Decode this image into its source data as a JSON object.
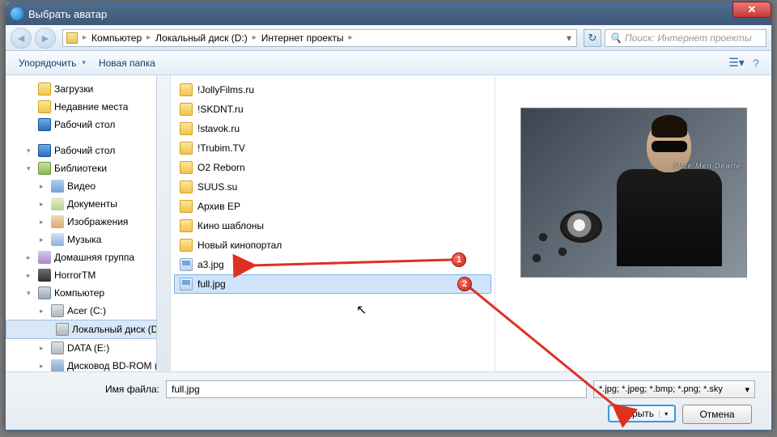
{
  "title": "Выбрать аватар",
  "breadcrumb": [
    "Компьютер",
    "Локальный диск (D:)",
    "Интернет проекты"
  ],
  "search_placeholder": "Поиск: Интернет проекты",
  "toolbar": {
    "organize": "Упорядочить",
    "newfolder": "Новая папка"
  },
  "tree": [
    {
      "t": "Загрузки",
      "c": "folder",
      "l": 1
    },
    {
      "t": "Недавние места",
      "c": "folder",
      "l": 1
    },
    {
      "t": "Рабочий стол",
      "c": "desktop",
      "l": 1
    },
    {
      "t": "",
      "spacer": true
    },
    {
      "t": "Рабочий стол",
      "c": "desktop",
      "l": 0,
      "exp": "▾"
    },
    {
      "t": "Библиотеки",
      "c": "lib",
      "l": 1,
      "exp": "▾"
    },
    {
      "t": "Видео",
      "c": "vid",
      "l": 2,
      "exp": "▸"
    },
    {
      "t": "Документы",
      "c": "doc",
      "l": 2,
      "exp": "▸"
    },
    {
      "t": "Изображения",
      "c": "img",
      "l": 2,
      "exp": "▸"
    },
    {
      "t": "Музыка",
      "c": "mus",
      "l": 2,
      "exp": "▸"
    },
    {
      "t": "Домашняя группа",
      "c": "grp",
      "l": 1,
      "exp": "▸"
    },
    {
      "t": "HorrorTM",
      "c": "tm",
      "l": 1,
      "exp": "▸"
    },
    {
      "t": "Компьютер",
      "c": "pc",
      "l": 1,
      "exp": "▾"
    },
    {
      "t": "Acer (C:)",
      "c": "drive",
      "l": 2,
      "exp": "▸"
    },
    {
      "t": "Локальный диск (D:",
      "c": "drive",
      "l": 2,
      "sel": true
    },
    {
      "t": "DATA (E:)",
      "c": "drive",
      "l": 2,
      "exp": "▸"
    },
    {
      "t": "Дисковод BD-ROM (I",
      "c": "bd",
      "l": 2,
      "exp": "▸"
    }
  ],
  "files": [
    {
      "t": "!JollyFilms.ru",
      "c": "folder"
    },
    {
      "t": "!SKDNT.ru",
      "c": "folder"
    },
    {
      "t": "!stavok.ru",
      "c": "folder"
    },
    {
      "t": "!Trubim.TV",
      "c": "folder"
    },
    {
      "t": "O2 Reborn",
      "c": "folder"
    },
    {
      "t": "SUUS.su",
      "c": "folder"
    },
    {
      "t": "Архив ЕР",
      "c": "folder"
    },
    {
      "t": "Кино шаблоны",
      "c": "folder"
    },
    {
      "t": "Новый кинопортал",
      "c": "folder"
    },
    {
      "t": "a3.jpg",
      "c": "jpg"
    },
    {
      "t": "full.jpg",
      "c": "jpg",
      "sel": true
    }
  ],
  "preview_text": "Slice Men Dearle",
  "footer": {
    "label": "Имя файла:",
    "value": "full.jpg",
    "filter": "*.jpg; *.jpeg; *.bmp; *.png; *.sky",
    "open": "Открыть",
    "cancel": "Отмена"
  },
  "ann": {
    "b1": "1",
    "b2": "2"
  }
}
